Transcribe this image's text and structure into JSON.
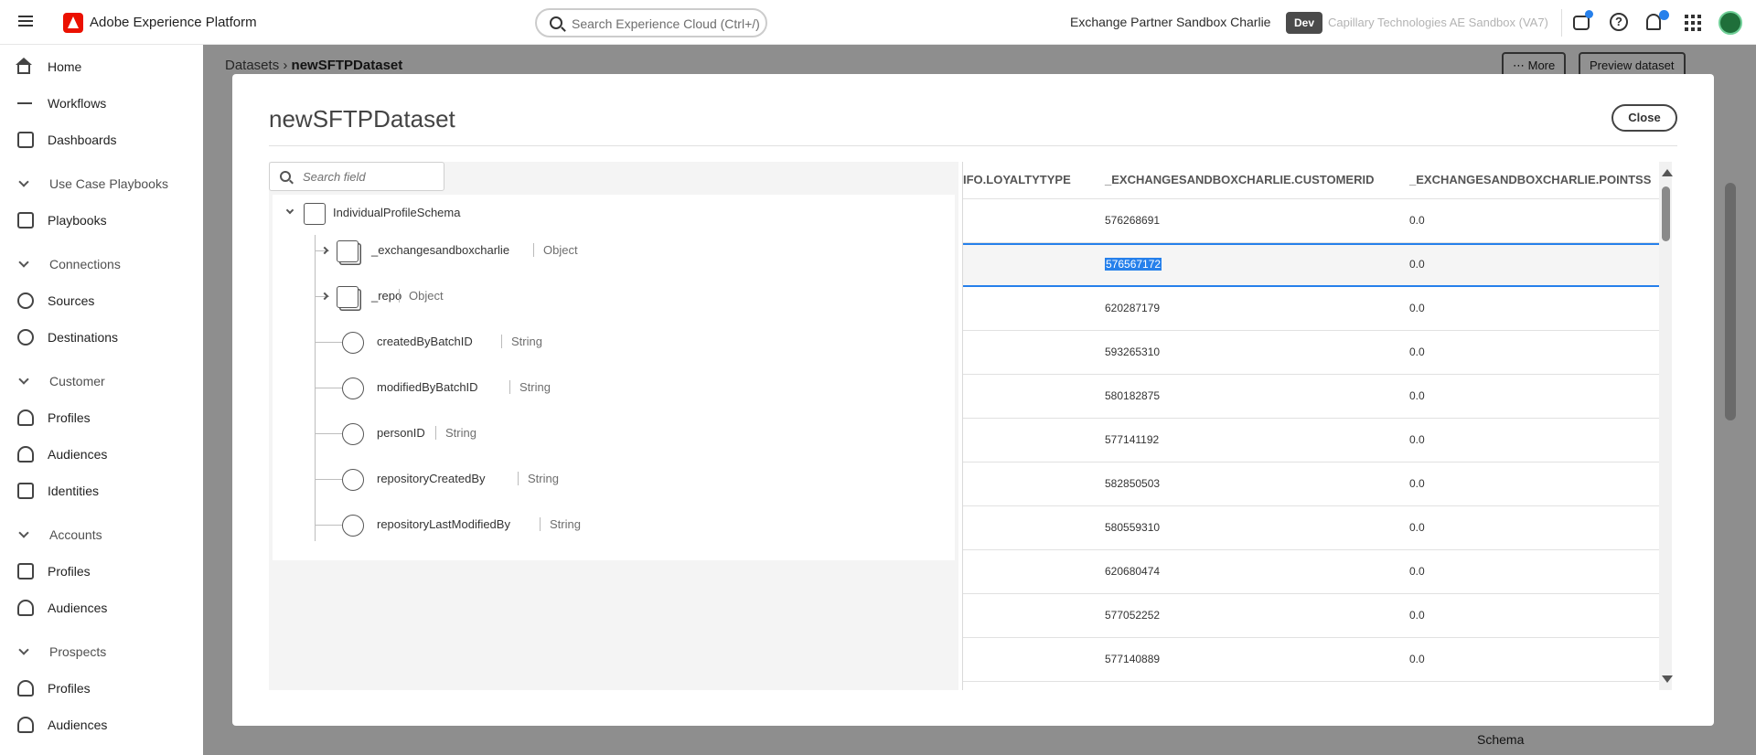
{
  "app": {
    "title": "Adobe Experience Platform"
  },
  "search": {
    "placeholder": "Search Experience Cloud (Ctrl+/)"
  },
  "header": {
    "org_name": "Exchange Partner Sandbox Charlie",
    "env_badge": "Dev",
    "sandbox_name": "Capillary Technologies AE Sandbox (VA7)"
  },
  "sidebar": {
    "items": [
      {
        "label": "Home"
      },
      {
        "label": "Workflows"
      },
      {
        "label": "Dashboards"
      }
    ],
    "sections": [
      {
        "label": "Use Case Playbooks",
        "items": [
          {
            "label": "Playbooks"
          }
        ]
      },
      {
        "label": "Connections",
        "items": [
          {
            "label": "Sources"
          },
          {
            "label": "Destinations"
          }
        ]
      },
      {
        "label": "Customer",
        "items": [
          {
            "label": "Profiles"
          },
          {
            "label": "Audiences"
          },
          {
            "label": "Identities"
          }
        ]
      },
      {
        "label": "Accounts",
        "items": [
          {
            "label": "Profiles"
          },
          {
            "label": "Audiences"
          }
        ]
      },
      {
        "label": "Prospects",
        "items": [
          {
            "label": "Profiles"
          },
          {
            "label": "Audiences"
          }
        ]
      }
    ]
  },
  "background": {
    "breadcrumb_parent": "Datasets",
    "breadcrumb_current": "newSFTPDataset",
    "more_label": "More",
    "preview_label": "Preview dataset",
    "schema_label": "Schema"
  },
  "modal": {
    "title": "newSFTPDataset",
    "close_label": "Close",
    "field_search_placeholder": "Search field",
    "tree": {
      "root": "IndividualProfileSchema",
      "nodes": [
        {
          "name": "_exchangesandboxcharlie",
          "type": "Object"
        },
        {
          "name": "_repo",
          "type": "Object"
        },
        {
          "name": "createdByBatchID",
          "type": "String"
        },
        {
          "name": "modifiedByBatchID",
          "type": "String"
        },
        {
          "name": "personID",
          "type": "String"
        },
        {
          "name": "repositoryCreatedBy",
          "type": "String"
        },
        {
          "name": "repositoryLastModifiedBy",
          "type": "String"
        }
      ]
    },
    "table": {
      "columns": [
        "IFO.LOYALTYTYPE",
        "_EXCHANGESANDBOXCHARLIE.CUSTOMERID",
        "_EXCHANGESANDBOXCHARLIE.POINTSS"
      ],
      "rows": [
        {
          "loyalty": "",
          "customer_id": "576268691",
          "points": "0.0"
        },
        {
          "loyalty": "",
          "customer_id": "576567172",
          "points": "0.0"
        },
        {
          "loyalty": "",
          "customer_id": "620287179",
          "points": "0.0"
        },
        {
          "loyalty": "",
          "customer_id": "593265310",
          "points": "0.0"
        },
        {
          "loyalty": "",
          "customer_id": "580182875",
          "points": "0.0"
        },
        {
          "loyalty": "",
          "customer_id": "577141192",
          "points": "0.0"
        },
        {
          "loyalty": "",
          "customer_id": "582850503",
          "points": "0.0"
        },
        {
          "loyalty": "",
          "customer_id": "580559310",
          "points": "0.0"
        },
        {
          "loyalty": "",
          "customer_id": "620680474",
          "points": "0.0"
        },
        {
          "loyalty": "",
          "customer_id": "577052252",
          "points": "0.0"
        },
        {
          "loyalty": "",
          "customer_id": "577140889",
          "points": "0.0"
        }
      ]
    }
  },
  "colors": {
    "accent": "#2680eb",
    "brand": "#eb1000",
    "overlay": "#000000"
  }
}
